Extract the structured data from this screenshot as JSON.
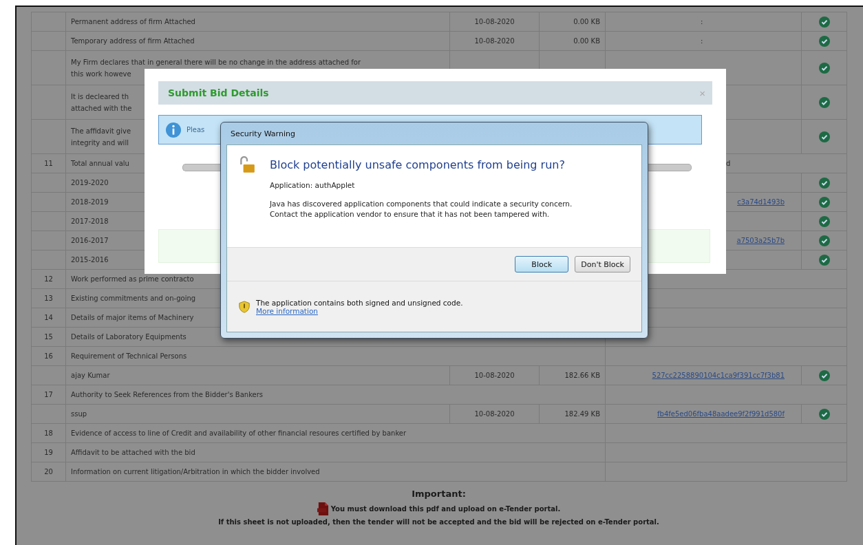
{
  "table": {
    "rows": [
      {
        "kind": "file",
        "lines": [
          "Permanent address of firm Attached"
        ],
        "date": "10-08-2020",
        "size": "0.00 KB",
        "hash": ":",
        "verified": true
      },
      {
        "kind": "file",
        "lines": [
          "Temporary address of firm Attached"
        ],
        "date": "10-08-2020",
        "size": "0.00 KB",
        "hash": ":",
        "verified": true
      },
      {
        "kind": "file",
        "lines": [
          "My Firm declares that in general there will be no change in the address attached for",
          "this work howeve"
        ],
        "verified": true
      },
      {
        "kind": "file",
        "lines": [
          "It is decleared th",
          "attached with the"
        ],
        "verified": true
      },
      {
        "kind": "file",
        "lines": [
          "The affidavit give",
          "integrity and will"
        ],
        "verified": true
      },
      {
        "kind": "item",
        "number": "11",
        "lines": [
          "Total annual valu"
        ],
        "note": "d"
      },
      {
        "kind": "file",
        "lines": [
          "2019-2020"
        ],
        "verified": true
      },
      {
        "kind": "file",
        "lines": [
          "2018-2019"
        ],
        "hash": "c3a74d1493b",
        "verified": true
      },
      {
        "kind": "file",
        "lines": [
          "2017-2018"
        ],
        "verified": true
      },
      {
        "kind": "file",
        "lines": [
          "2016-2017"
        ],
        "hash": "a7503a25b7b",
        "verified": true
      },
      {
        "kind": "file",
        "lines": [
          "2015-2016"
        ],
        "verified": true
      },
      {
        "kind": "item",
        "number": "12",
        "lines": [
          "Work performed as prime contracto"
        ]
      },
      {
        "kind": "item",
        "number": "13",
        "lines": [
          "Existing commitments and on-going"
        ]
      },
      {
        "kind": "item",
        "number": "14",
        "lines": [
          "Details of major items of Machinery"
        ]
      },
      {
        "kind": "item",
        "number": "15",
        "lines": [
          "Details of Laboratory Equipments"
        ]
      },
      {
        "kind": "item",
        "number": "16",
        "lines": [
          "Requirement of Technical Persons"
        ]
      },
      {
        "kind": "file",
        "lines": [
          "ajay Kumar"
        ],
        "date": "10-08-2020",
        "size": "182.66 KB",
        "hash": "527cc2258890104c1ca9f391cc7f3b81",
        "verified": true
      },
      {
        "kind": "item",
        "number": "17",
        "lines": [
          "Authority to Seek References from the Bidder's Bankers"
        ]
      },
      {
        "kind": "file",
        "lines": [
          "ssup"
        ],
        "date": "10-08-2020",
        "size": "182.49 KB",
        "hash": "fb4fe5ed06fba48aadee9f2f991d580f",
        "verified": true
      },
      {
        "kind": "item",
        "number": "18",
        "lines": [
          "Evidence of access to line of Credit and availability of other financial resoures certified by banker"
        ]
      },
      {
        "kind": "item",
        "number": "19",
        "lines": [
          "Affidavit to be attached with the bid"
        ]
      },
      {
        "kind": "item",
        "number": "20",
        "lines": [
          "Information on current litigation/Arbitration in which the bidder involved"
        ]
      }
    ]
  },
  "important": {
    "heading": "Important:",
    "line1": "You must download this pdf and upload on e-Tender portal.",
    "line2": "If this sheet is not uploaded, then the tender will not be accepted and the bid will be rejected on e-Tender portal."
  },
  "submit_dialog": {
    "title": "Submit Bid Details",
    "close": "×",
    "info": "Pleas"
  },
  "security_dialog": {
    "title": "Security Warning",
    "heading": "Block potentially unsafe components from being run?",
    "application": "Application: authApplet",
    "message": "Java has discovered application components that could indicate a security concern. Contact the application vendor to ensure that it has not been tampered with.",
    "buttons": [
      {
        "label": "Block",
        "selected": true
      },
      {
        "label": "Don't Block",
        "selected": false
      }
    ],
    "footer": "The application contains both signed and unsigned code.",
    "link": "More information"
  }
}
